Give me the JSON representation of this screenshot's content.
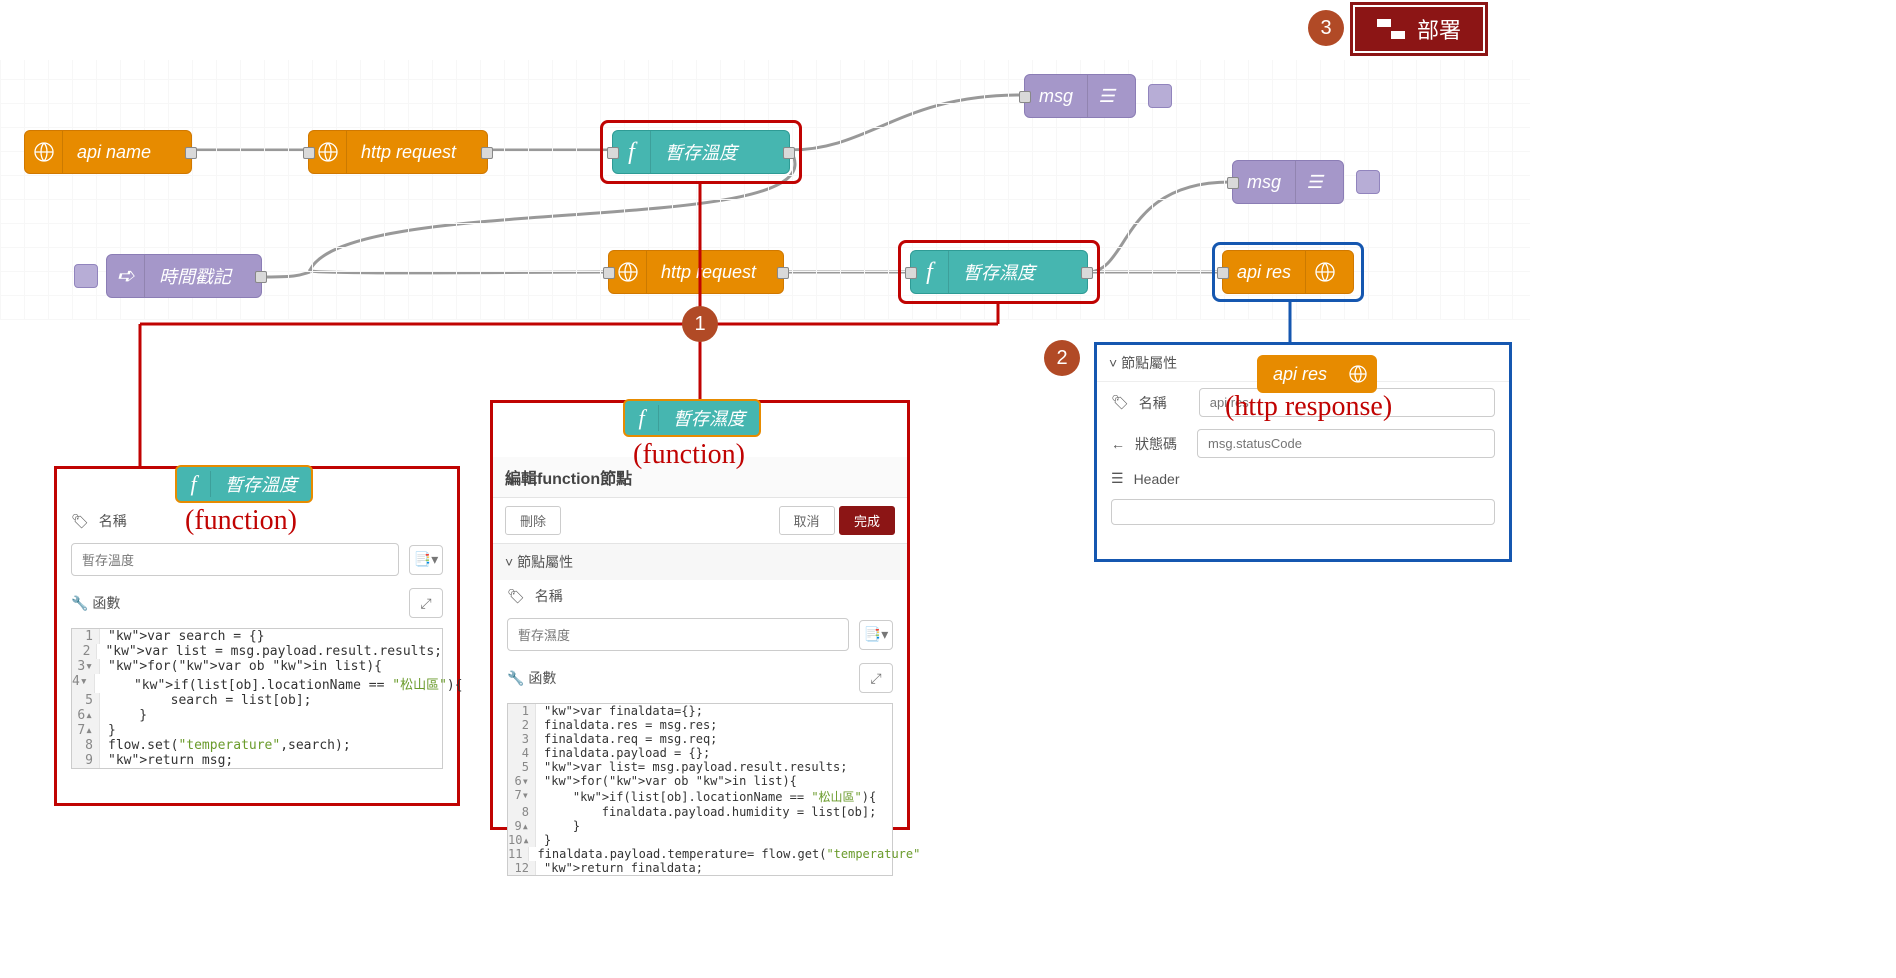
{
  "deploy": {
    "label": "部署"
  },
  "badges": {
    "one": "1",
    "two": "2",
    "three": "3"
  },
  "nodes": {
    "api_name": "api name",
    "http_req1": "http request",
    "http_req2": "http request",
    "temp_fn": "暫存溫度",
    "humid_fn": "暫存濕度",
    "timestamp": "時間戳記",
    "msg1": "msg",
    "msg2": "msg",
    "api_res": "api res"
  },
  "annotation": {
    "function": "(function)",
    "http_response": "(http response)"
  },
  "panel1": {
    "name_label": "名稱",
    "name_value": "暫存溫度",
    "func_label": "函數",
    "code": [
      {
        "n": "1",
        "t": "var search = {}"
      },
      {
        "n": "2",
        "t": "var list = msg.payload.result.results;"
      },
      {
        "n": "3▾",
        "t": "for(var ob in list){"
      },
      {
        "n": "4▾",
        "t": "    if(list[ob].locationName == \"松山區\"){"
      },
      {
        "n": "5",
        "t": "        search = list[ob];"
      },
      {
        "n": "6▴",
        "t": "    }"
      },
      {
        "n": "7▴",
        "t": "}"
      },
      {
        "n": "8",
        "t": "flow.set(\"temperature\",search);"
      },
      {
        "n": "9",
        "t": "return msg;"
      }
    ]
  },
  "panel2": {
    "title": "編輯function節點",
    "delete": "刪除",
    "cancel": "取消",
    "done": "完成",
    "section": "節點屬性",
    "name_label": "名稱",
    "name_value": "暫存濕度",
    "func_label": "函數",
    "code": [
      {
        "n": "1",
        "t": "var finaldata={};"
      },
      {
        "n": "2",
        "t": "finaldata.res = msg.res;"
      },
      {
        "n": "3",
        "t": "finaldata.req = msg.req;"
      },
      {
        "n": "4",
        "t": "finaldata.payload = {};"
      },
      {
        "n": "5",
        "t": "var list= msg.payload.result.results;"
      },
      {
        "n": "6▾",
        "t": "for(var ob in list){"
      },
      {
        "n": "7▾",
        "t": "    if(list[ob].locationName == \"松山區\"){"
      },
      {
        "n": "8",
        "t": "        finaldata.payload.humidity = list[ob];"
      },
      {
        "n": "9▴",
        "t": "    }"
      },
      {
        "n": "10▴",
        "t": "}"
      },
      {
        "n": "11",
        "t": "finaldata.payload.temperature= flow.get(\"temperature\""
      },
      {
        "n": "12",
        "t": "return finaldata;"
      }
    ]
  },
  "panel3": {
    "section": "節點屬性",
    "name_label": "名稱",
    "name_value": "api res",
    "status_label": "狀態碼",
    "status_placeholder": "msg.statusCode",
    "header_label": "Header"
  }
}
